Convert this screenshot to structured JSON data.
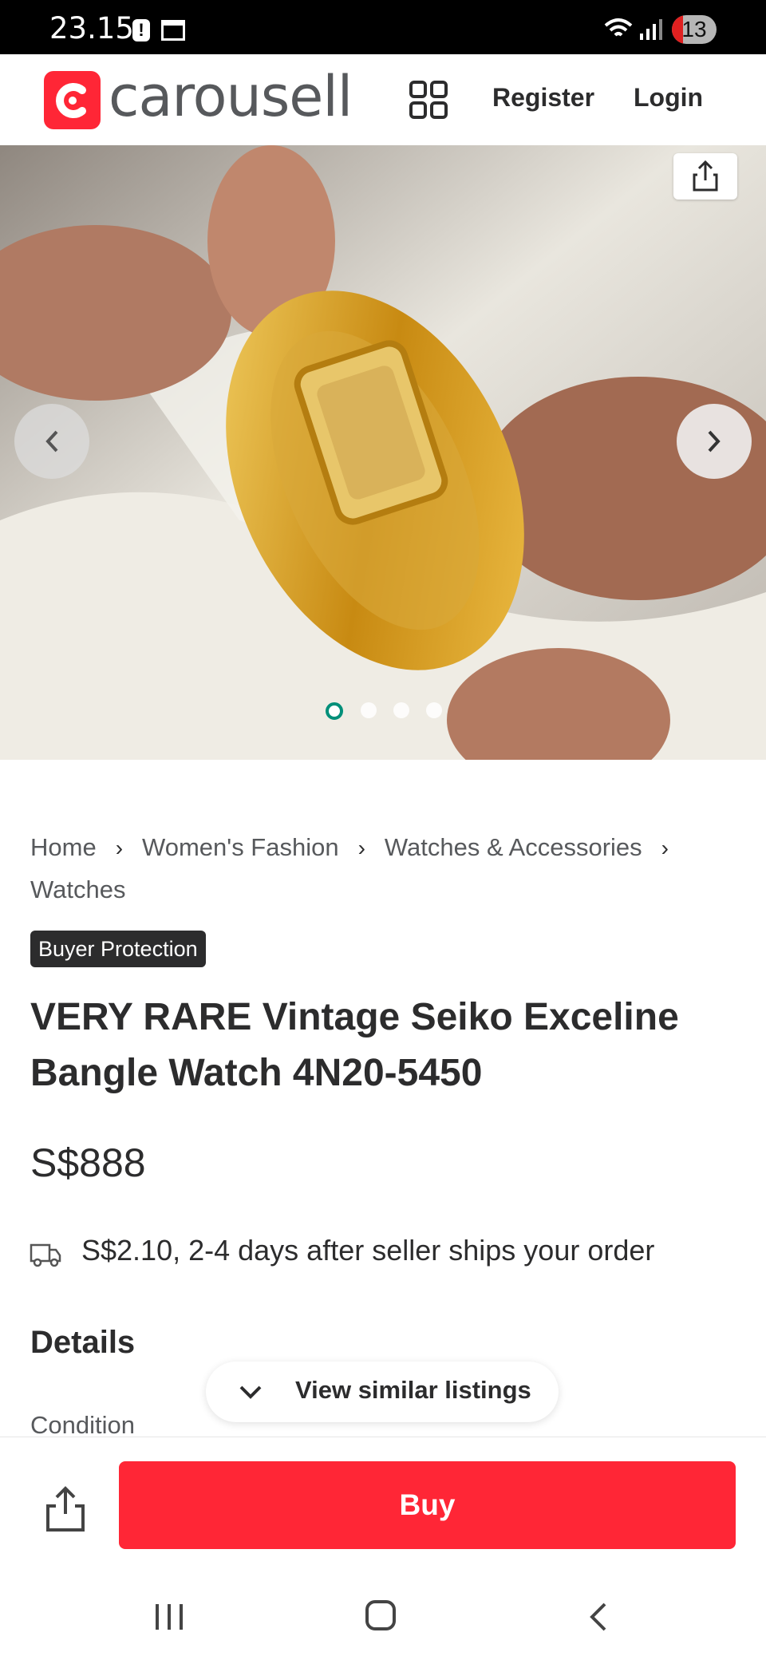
{
  "status_bar": {
    "time": "23.15",
    "battery_level": "13"
  },
  "header": {
    "logo_text": "carousell",
    "register_label": "Register",
    "login_label": "Login"
  },
  "gallery": {
    "image_count": 4,
    "active_index": 0
  },
  "breadcrumb": {
    "items": [
      "Home",
      "Women's Fashion",
      "Watches & Accessories",
      "Watches"
    ]
  },
  "badge": "Buyer Protection",
  "listing": {
    "title": "VERY RARE Vintage Seiko Exceline Bangle Watch 4N20-5450",
    "price": "S$888",
    "shipping": "S$2.10, 2-4 days after seller ships your order"
  },
  "sections": {
    "details_heading": "Details",
    "condition_label": "Condition"
  },
  "similar_button": "View similar listings",
  "bottom_bar": {
    "buy_label": "Buy"
  },
  "colors": {
    "brand_red": "#ff2636",
    "active_dot": "#008f79",
    "text_dark": "#2c2c2d"
  }
}
